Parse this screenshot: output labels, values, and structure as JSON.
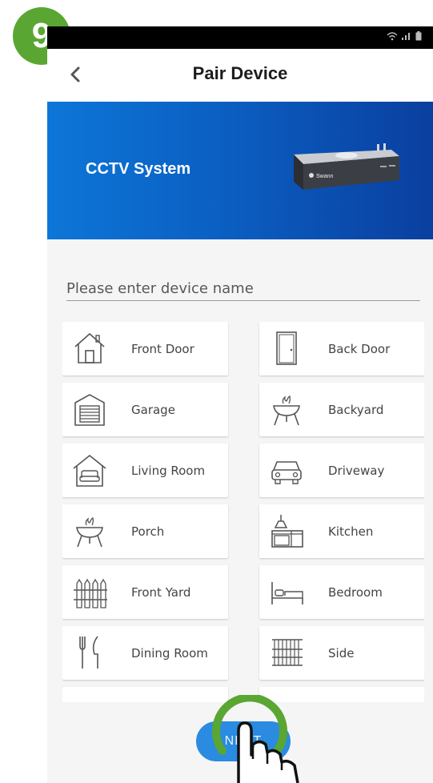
{
  "step": {
    "number": "9"
  },
  "header": {
    "title": "Pair Device"
  },
  "banner": {
    "title": "CCTV System",
    "device_brand": "Swann"
  },
  "name_input": {
    "placeholder": "Please enter device name",
    "value": ""
  },
  "locations": [
    {
      "label": "Front Door",
      "icon": "house-door-icon"
    },
    {
      "label": "Back Door",
      "icon": "door-icon"
    },
    {
      "label": "Garage",
      "icon": "garage-icon"
    },
    {
      "label": "Backyard",
      "icon": "grill-icon"
    },
    {
      "label": "Living Room",
      "icon": "sofa-house-icon"
    },
    {
      "label": "Driveway",
      "icon": "car-icon"
    },
    {
      "label": "Porch",
      "icon": "grill-icon"
    },
    {
      "label": "Kitchen",
      "icon": "kitchen-icon"
    },
    {
      "label": "Front Yard",
      "icon": "fence-icon"
    },
    {
      "label": "Bedroom",
      "icon": "bed-icon"
    },
    {
      "label": "Dining Room",
      "icon": "cutlery-icon"
    },
    {
      "label": "Side",
      "icon": "side-fence-icon"
    }
  ],
  "next_button": {
    "label": "NEXT"
  },
  "colors": {
    "accent": "#2a8be0",
    "badge": "#5aa632",
    "banner_start": "#0d76d8",
    "banner_end": "#0a3f9f"
  }
}
